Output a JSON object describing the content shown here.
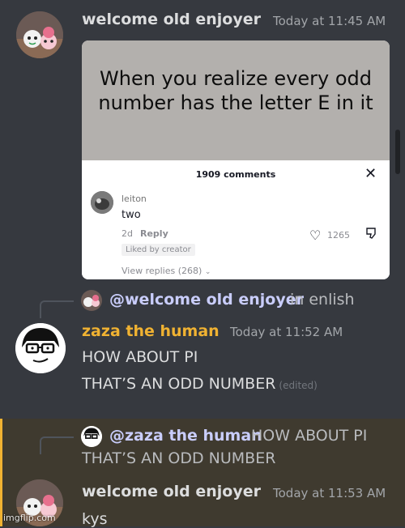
{
  "messages": [
    {
      "author": "welcome old enjoyer",
      "author_color": "#dcddde",
      "time": "Today at 11:45 AM",
      "embed": {
        "caption": "When you realize every odd number has the letter E in it",
        "comments_header": "1909 comments",
        "comment_user": "leiton",
        "comment_text": "two",
        "comment_age": "2d",
        "reply_label": "Reply",
        "likes": "1265",
        "liked_by": "Liked by creator",
        "view_replies": "View replies (268)"
      }
    },
    {
      "reply_preview": {
        "mention": "@welcome old enjoyer",
        "text": "in enlish"
      },
      "author": "zaza the human",
      "author_color": "#f0b232",
      "time": "Today at 11:52 AM",
      "lines": [
        "HOW ABOUT PI",
        "THAT’S AN ODD NUMBER"
      ],
      "edited": "(edited)"
    },
    {
      "highlighted": true,
      "reply_preview": {
        "mention": "@zaza the human",
        "text": "HOW ABOUT PI",
        "text_line2": "THAT’S AN ODD NUMBER"
      },
      "author": "welcome old enjoyer",
      "author_color": "#dcddde",
      "time": "Today at 11:53 AM",
      "lines": [
        "kys"
      ]
    }
  ],
  "watermark": "imgflip.com",
  "colors": {
    "background": "#36393f",
    "highlight_bg": "#3f3a2f",
    "highlight_bar": "#f0b232",
    "mention": "#c9cdfb"
  }
}
